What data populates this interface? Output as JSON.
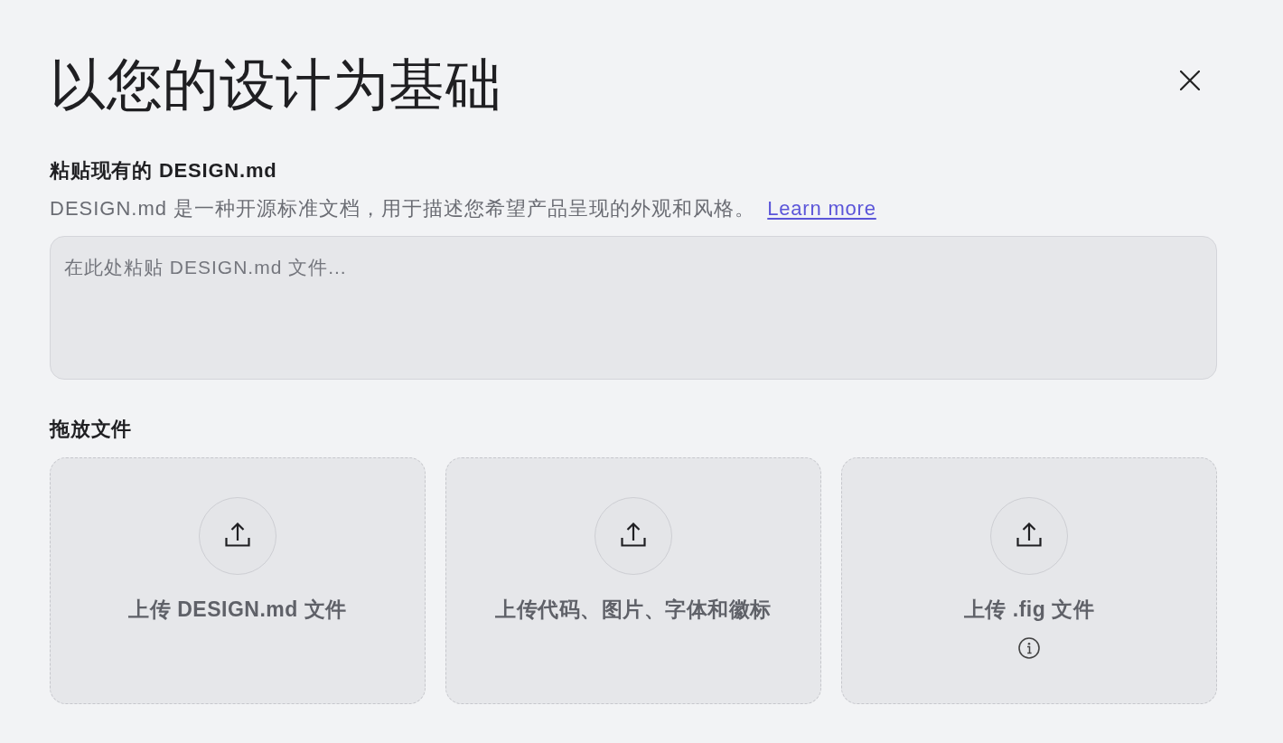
{
  "title": "以您的设计为基础",
  "paste_section": {
    "heading": "粘贴现有的 DESIGN.md",
    "description": "DESIGN.md 是一种开源标准文档，用于描述您希望产品呈现的外观和风格。",
    "link": "Learn more",
    "placeholder": "在此处粘贴 DESIGN.md 文件..."
  },
  "drop_section": {
    "heading": "拖放文件",
    "cards": [
      {
        "label": "上传 DESIGN.md 文件",
        "info": false
      },
      {
        "label": "上传代码、图片、字体和徽标",
        "info": false
      },
      {
        "label": "上传 .fig 文件",
        "info": true
      }
    ]
  }
}
